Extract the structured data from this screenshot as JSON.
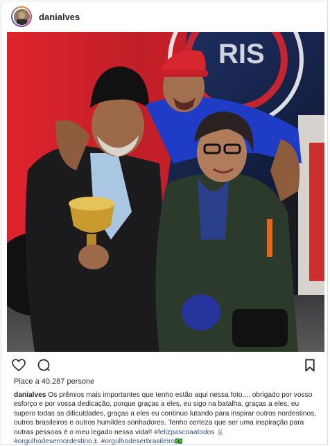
{
  "post": {
    "username": "danialves",
    "likes_text": "Piace a 40.287 persone",
    "caption_user": "danialves",
    "caption_text": " Os prêmios mais importantes que tenho estão aqui nessa foto.... obrigado por vosso esforço e por vossa dedicação, porque graças a eles, eu sigo na batalha, graças a eles, eu supero todas as dificuldades, graças a eles eu continuo lutando para inspirar outros nordestinos, outros brasileiros e outros humildes sonhadores. Tenho certeza que ser uma inspiração para outras pessoas é o meu legado nessa vida!! ",
    "hashtags": [
      "#felizpascoaatodos",
      "#orgulhodesernordestino",
      "#orgulhodeserbrasileiro"
    ],
    "hashtag_suffix_1": "🐰",
    "hashtag_suffix_2": "⚓",
    "hashtag_suffix_3": "🇧🇷"
  },
  "icons": {
    "like": "heart-icon",
    "comment": "comment-icon",
    "save": "bookmark-icon"
  },
  "colors": {
    "text": "#262626",
    "hashtag": "#385185",
    "border": "#dbdbdb",
    "bus_red": "#d8262f"
  }
}
